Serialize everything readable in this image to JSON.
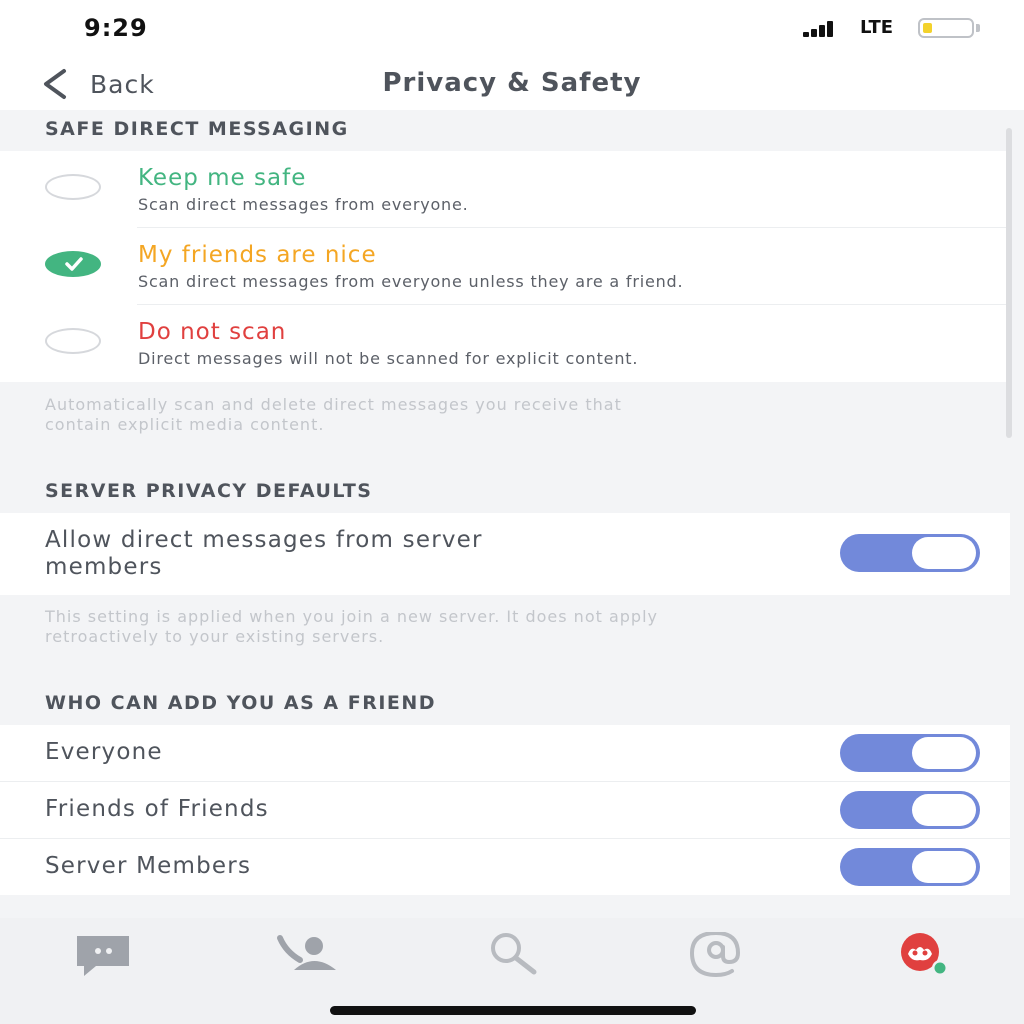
{
  "status": {
    "time": "9:29",
    "network": "LTE"
  },
  "nav": {
    "back_label": "Back",
    "title": "Privacy & Safety"
  },
  "safe_dm": {
    "header": "SAFE DIRECT MESSAGING",
    "options": [
      {
        "title": "Keep me safe",
        "desc": "Scan direct messages from everyone.",
        "color": "#43b581",
        "checked": false
      },
      {
        "title": "My friends are nice",
        "desc": "Scan direct messages from everyone unless they are a friend.",
        "color": "#f4a623",
        "checked": true
      },
      {
        "title": "Do not scan",
        "desc": "Direct messages will not be scanned for explicit content.",
        "color": "#e0403f",
        "checked": false
      }
    ],
    "note_lines": [
      "Automatically scan and delete direct messages you receive that",
      "contain explicit media content."
    ]
  },
  "server_privacy": {
    "header": "SERVER PRIVACY DEFAULTS",
    "setting_lines": [
      "Allow direct messages from server",
      "members"
    ],
    "enabled": true,
    "note_lines": [
      "This setting is applied when you join a new server. It does not apply",
      "retroactively to your existing servers."
    ]
  },
  "friend_requests": {
    "header": "WHO CAN ADD YOU AS A FRIEND",
    "rows": [
      {
        "label": "Everyone",
        "enabled": true
      },
      {
        "label": "Friends of Friends",
        "enabled": true
      },
      {
        "label": "Server Members",
        "enabled": true
      }
    ]
  },
  "tabs": [
    {
      "icon": "chat-icon"
    },
    {
      "icon": "friends-icon"
    },
    {
      "icon": "search-icon"
    },
    {
      "icon": "mentions-icon"
    },
    {
      "icon": "profile-icon",
      "status": "online"
    }
  ],
  "colors": {
    "accent": "#7289da",
    "online": "#43b581",
    "brand_red": "#e0403f"
  }
}
